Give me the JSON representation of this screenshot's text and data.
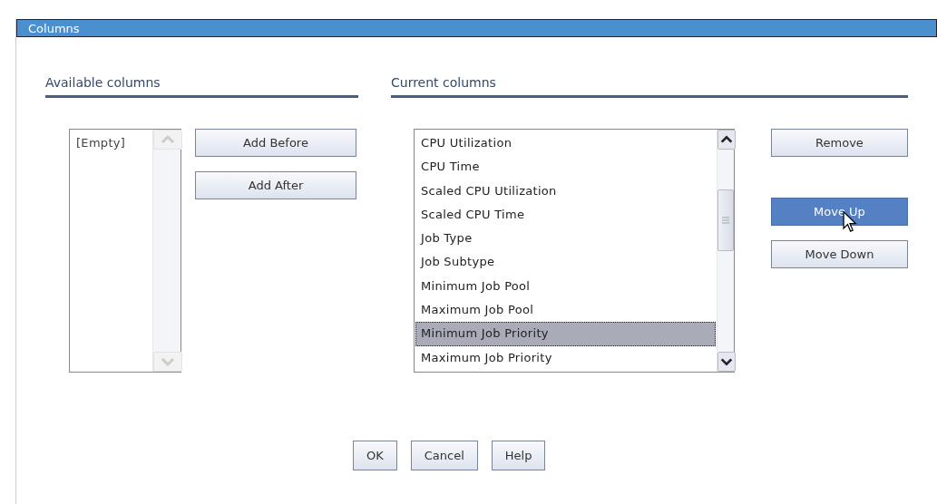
{
  "window": {
    "title": "Columns"
  },
  "available": {
    "heading": "Available columns",
    "items": [
      {
        "label": "[Empty]",
        "selected": false
      }
    ],
    "buttons": [
      {
        "label": "Add Before",
        "highlighted": false
      },
      {
        "label": "Add After",
        "highlighted": false
      }
    ]
  },
  "current": {
    "heading": "Current columns",
    "items": [
      {
        "label": "CPU Utilization",
        "selected": false
      },
      {
        "label": "CPU Time",
        "selected": false
      },
      {
        "label": "Scaled CPU Utilization",
        "selected": false
      },
      {
        "label": "Scaled CPU Time",
        "selected": false
      },
      {
        "label": "Job Type",
        "selected": false
      },
      {
        "label": "Job Subtype",
        "selected": false
      },
      {
        "label": "Minimum Job Pool",
        "selected": false
      },
      {
        "label": "Maximum Job Pool",
        "selected": false
      },
      {
        "label": "Minimum Job Priority",
        "selected": true
      },
      {
        "label": "Maximum Job Priority",
        "selected": false
      }
    ],
    "buttons": [
      {
        "label": "Remove",
        "highlighted": false
      },
      {
        "label": "Move Up",
        "highlighted": true
      },
      {
        "label": "Move Down",
        "highlighted": false
      }
    ]
  },
  "footer_buttons": [
    {
      "label": "OK",
      "highlighted": false
    },
    {
      "label": "Cancel",
      "highlighted": false
    },
    {
      "label": "Help",
      "highlighted": false
    }
  ]
}
